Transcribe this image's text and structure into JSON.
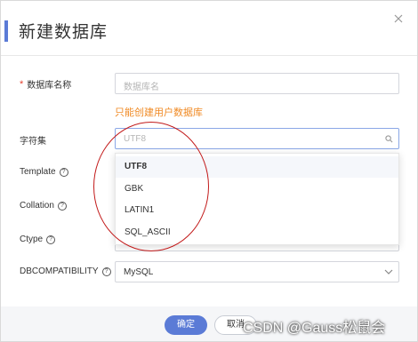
{
  "dialog": {
    "title": "新建数据库",
    "close_icon": "close-icon",
    "accent_color": "#5b7bd6"
  },
  "form": {
    "db_name": {
      "required_mark": "*",
      "label": "数据库名称",
      "placeholder": "数据库名",
      "hint": "只能创建用户数据库",
      "hint_color": "#f08a24"
    },
    "charset": {
      "label": "字符集",
      "placeholder": "UTF8",
      "icon": "search-icon",
      "options": [
        "UTF8",
        "GBK",
        "LATIN1",
        "SQL_ASCII"
      ],
      "selected_option": "UTF8"
    },
    "template": {
      "label": "Template",
      "help_icon": "?"
    },
    "collation": {
      "label": "Collation",
      "help_icon": "?"
    },
    "ctype": {
      "label": "Ctype",
      "help_icon": "?"
    },
    "dbcompatibility": {
      "label": "DBCOMPATIBILITY",
      "help_icon": "?",
      "value": "MySQL",
      "icon": "chevron-down-icon"
    }
  },
  "footer": {
    "ok_label": "确定",
    "cancel_label": "取消"
  },
  "watermark": "CSDN @Gauss松鼠会"
}
